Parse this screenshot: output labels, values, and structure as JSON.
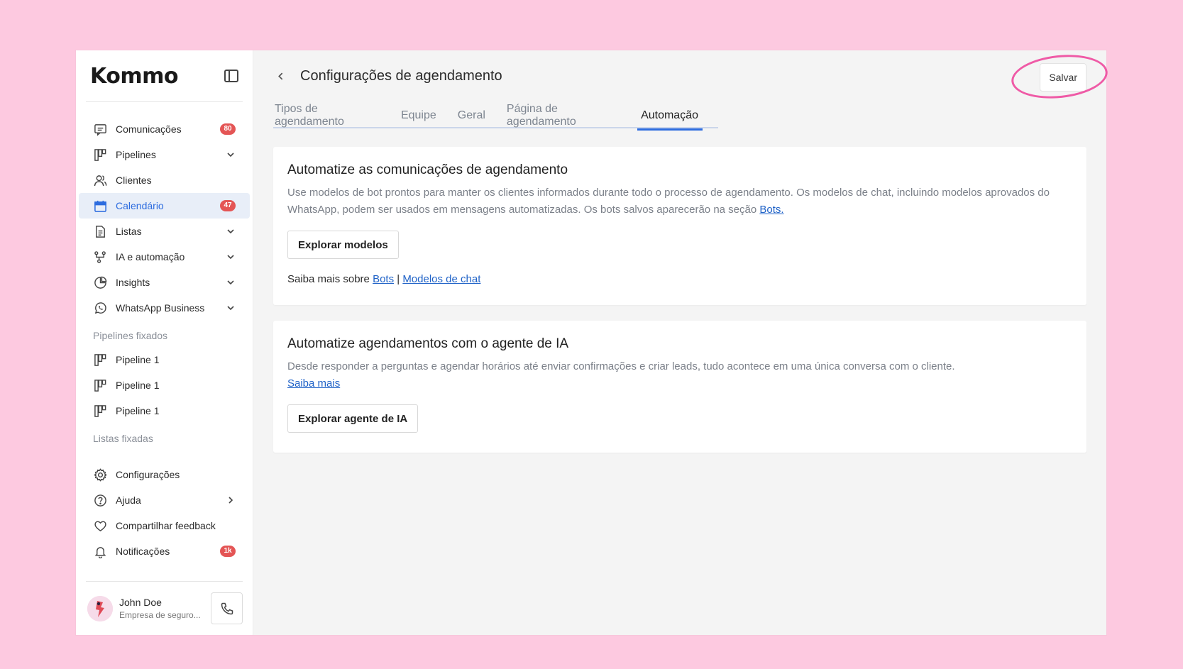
{
  "brand": {
    "logo_text": "Kommo"
  },
  "sidebar": {
    "items": [
      {
        "label": "Comunicações",
        "icon": "chat-icon",
        "badge": "80"
      },
      {
        "label": "Pipelines",
        "icon": "pipeline-icon",
        "chevron": "down"
      },
      {
        "label": "Clientes",
        "icon": "users-icon"
      },
      {
        "label": "Calendário",
        "icon": "calendar-icon",
        "badge": "47",
        "active": true
      },
      {
        "label": "Listas",
        "icon": "document-icon",
        "chevron": "down"
      },
      {
        "label": "IA e automação",
        "icon": "automation-icon",
        "chevron": "down"
      },
      {
        "label": "Insights",
        "icon": "pie-chart-icon",
        "chevron": "down"
      },
      {
        "label": "WhatsApp Business",
        "icon": "whatsapp-icon",
        "chevron": "down"
      }
    ],
    "pinned_pipelines_label": "Pipelines fixados",
    "pinned_pipelines": [
      "Pipeline 1",
      "Pipeline 1",
      "Pipeline 1"
    ],
    "pinned_lists_label": "Listas fixadas",
    "bottom_items": [
      {
        "label": "Configurações",
        "icon": "gear-icon"
      },
      {
        "label": "Ajuda",
        "icon": "help-icon",
        "chevron": "right"
      },
      {
        "label": "Compartilhar feedback",
        "icon": "heart-icon"
      },
      {
        "label": "Notificações",
        "icon": "bell-icon",
        "badge": "1k"
      }
    ],
    "user": {
      "name": "John Doe",
      "company": "Empresa de seguro..."
    }
  },
  "header": {
    "title": "Configurações de agendamento",
    "save_label": "Salvar"
  },
  "tabs": [
    {
      "label": "Tipos de agendamento",
      "active": false
    },
    {
      "label": "Equipe",
      "active": false
    },
    {
      "label": "Geral",
      "active": false
    },
    {
      "label": "Página de agendamento",
      "active": false
    },
    {
      "label": "Automação",
      "active": true
    }
  ],
  "card1": {
    "title": "Automatize as comunicações de agendamento",
    "description": "Use modelos de bot prontos para manter os clientes informados durante todo o processo de agendamento. Os modelos de chat, incluindo modelos aprovados do WhatsApp, podem ser usados em mensagens automatizadas. Os bots salvos aparecerão na seção ",
    "description_link": "Bots.",
    "button_label": "Explorar modelos",
    "learn_more_prefix": "Saiba mais sobre ",
    "learn_more_link1": "Bots",
    "learn_more_separator": " | ",
    "learn_more_link2": "Modelos de chat"
  },
  "card2": {
    "title": "Automatize agendamentos com o agente de IA",
    "description": "Desde responder a perguntas e agendar horários até enviar confirmações e criar leads, tudo acontece em uma única conversa com o cliente.",
    "link": "Saiba mais",
    "button_label": "Explorar agente de IA"
  },
  "colors": {
    "background": "#fdc9e0",
    "accent": "#2d6cdf",
    "badge": "#e45555",
    "highlight": "#ef5aa6"
  }
}
